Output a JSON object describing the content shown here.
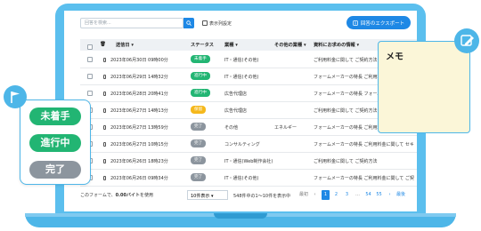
{
  "toolbar": {
    "search_placeholder": "回答を検索...",
    "column_settings_label": "表示列設定",
    "export_label": "回答のエクスポート"
  },
  "table": {
    "headers": [
      "送信日",
      "ステータス",
      "業種",
      "その他の業種",
      "資料にお求めの情報"
    ],
    "rows": [
      {
        "date": "2023年06月30日 09時00分",
        "status": "未着手",
        "status_color": "green",
        "industry": "IT・通信(その他)",
        "other": "",
        "info": "ご利用料金に関して ご契約方法"
      },
      {
        "date": "2023年06月29日 14時32分",
        "status": "進行中",
        "status_color": "green",
        "industry": "IT・通信(その他)",
        "other": "",
        "info": "フォームメーカーの特長 ご利用料金"
      },
      {
        "date": "2023年06月28日 20時41分",
        "status": "進行中",
        "status_color": "green",
        "industry": "広告代理店",
        "other": "",
        "info": "フォームメーカーの特長 フォームメ"
      },
      {
        "date": "2023年06月27日 14時13分",
        "status": "保留",
        "status_color": "yellow",
        "industry": "広告代理店",
        "other": "",
        "info": "ご利用料金に関して ご契約方法"
      },
      {
        "date": "2023年06月27日 13時59分",
        "status": "完了",
        "status_color": "gray",
        "industry": "その他",
        "other": "エネルギー",
        "info": "フォームメーカーの特長 ご利用料金"
      },
      {
        "date": "2023年06月27日 10時15分",
        "status": "完了",
        "status_color": "gray",
        "industry": "コンサルティング",
        "other": "",
        "info": "フォームメーカーの特長 ご利用料金に関して セキ"
      },
      {
        "date": "2023年06月26日 18時23分",
        "status": "完了",
        "status_color": "gray",
        "industry": "IT・通信(Web制作会社)",
        "other": "",
        "info": "ご利用料金に関して ご契約方法"
      },
      {
        "date": "2023年06月26日 09時34分",
        "status": "完了",
        "status_color": "gray",
        "industry": "IT・通信(その他)",
        "other": "",
        "info": "フォームメーカーの特長 ご利用料金に関して ご契"
      }
    ]
  },
  "footer": {
    "storage_prefix": "このフォームで、",
    "storage_value": "0.00バイト",
    "storage_suffix": "を使用",
    "per_page": "10件表示",
    "range": "548件中の1〜10件を表示中",
    "pager": [
      "最初",
      "‹",
      "1",
      "2",
      "3",
      "…",
      "54",
      "55",
      "›",
      "最後"
    ]
  },
  "status_card": {
    "labels": [
      "未着手",
      "進行中",
      "完了"
    ],
    "colors": [
      "#22b573",
      "#22b573",
      "#8c959e"
    ]
  },
  "memo": {
    "title": "メモ"
  },
  "colors": {
    "accent": "#1e88e5",
    "frame": "#5bbfee",
    "memo_bg": "#fbf6d8"
  }
}
